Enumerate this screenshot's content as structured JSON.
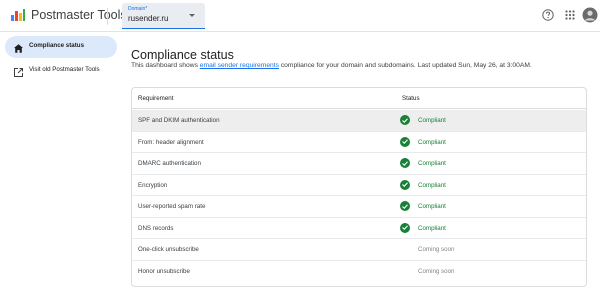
{
  "header": {
    "app_title": "Postmaster Tools",
    "domain_label": "Domain*",
    "domain_value": "rusender.ru"
  },
  "sidebar": {
    "items": [
      {
        "label": "Compliance status",
        "icon": "home-icon",
        "active": true
      },
      {
        "label": "Visit old Postmaster Tools",
        "icon": "open-external-icon",
        "active": false
      }
    ]
  },
  "main": {
    "title": "Compliance status",
    "description_prefix": "This dashboard shows ",
    "description_link": "email sender requirements",
    "description_suffix": " compliance for your domain and subdomains. Last updated Sun, May 26, at 3:00AM."
  },
  "table": {
    "headers": {
      "requirement": "Requirement",
      "status": "Status"
    },
    "rows": [
      {
        "requirement": "SPF and DKIM authentication",
        "status": "Compliant"
      },
      {
        "requirement": "From: header alignment",
        "status": "Compliant"
      },
      {
        "requirement": "DMARC authentication",
        "status": "Compliant"
      },
      {
        "requirement": "Encryption",
        "status": "Compliant"
      },
      {
        "requirement": "User-reported spam rate",
        "status": "Compliant"
      },
      {
        "requirement": "DNS records",
        "status": "Compliant"
      },
      {
        "requirement": "One-click unsubscribe",
        "status": "Coming soon"
      },
      {
        "requirement": "Honor unsubscribe",
        "status": "Coming soon"
      }
    ]
  },
  "colors": {
    "accent": "#1a73e8",
    "compliant": "#188038",
    "coming_soon": "#80868b",
    "active_nav": "#dbe9fb"
  }
}
